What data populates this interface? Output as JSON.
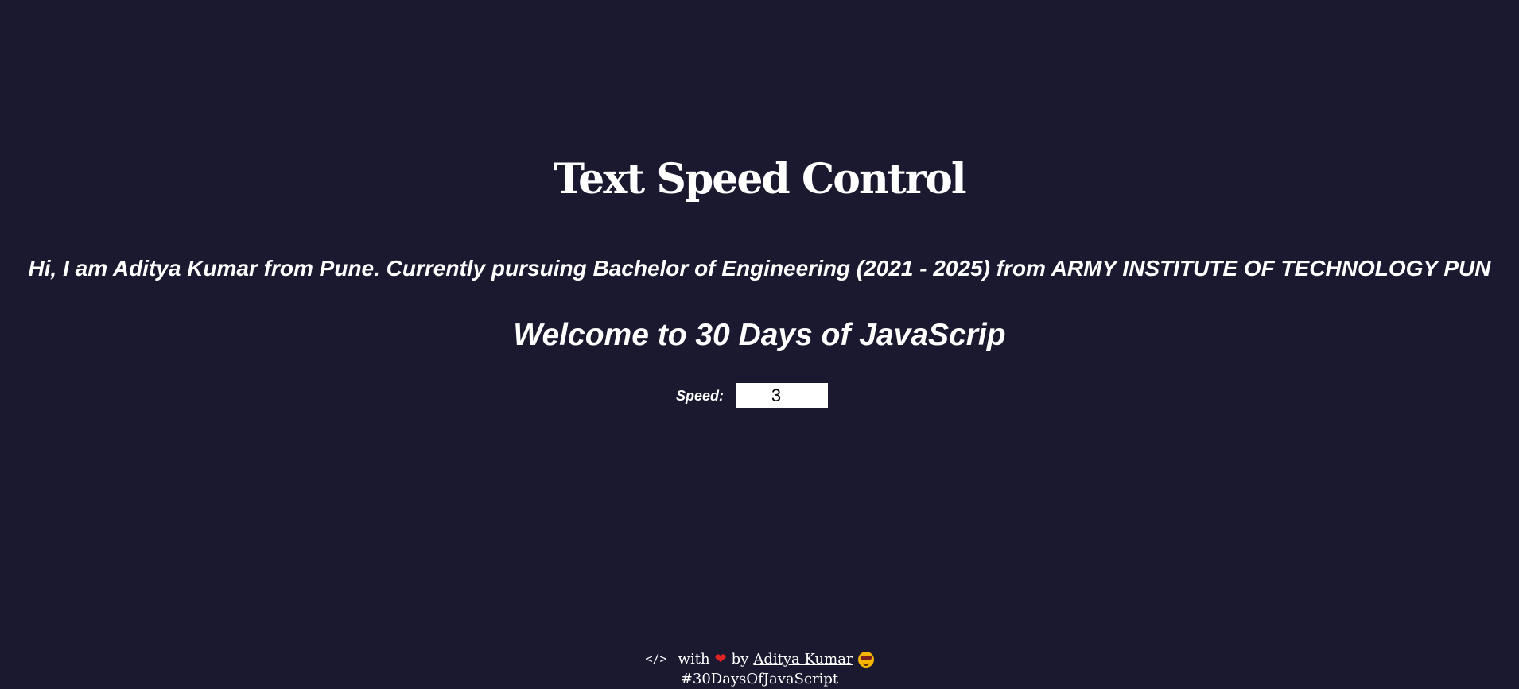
{
  "header": {
    "title": "Text Speed Control"
  },
  "main": {
    "intro_text": "Hi, I am Aditya Kumar from Pune. Currently pursuing Bachelor of Engineering (2021 - 2025) from ARMY INSTITUTE OF TECHNOLOGY PUN",
    "welcome_text": "Welcome to 30 Days of JavaScrip",
    "speed": {
      "label": "Speed:",
      "value": "3"
    }
  },
  "footer": {
    "code_symbol": "</>",
    "with_text": "with",
    "heart_symbol": "❤",
    "by_text": "by",
    "author_name": "Aditya Kumar",
    "hashtag": "#30DaysOfJavaScript"
  },
  "colors": {
    "background": "#1a1930",
    "text": "#ffffff",
    "heart": "#e02424"
  }
}
